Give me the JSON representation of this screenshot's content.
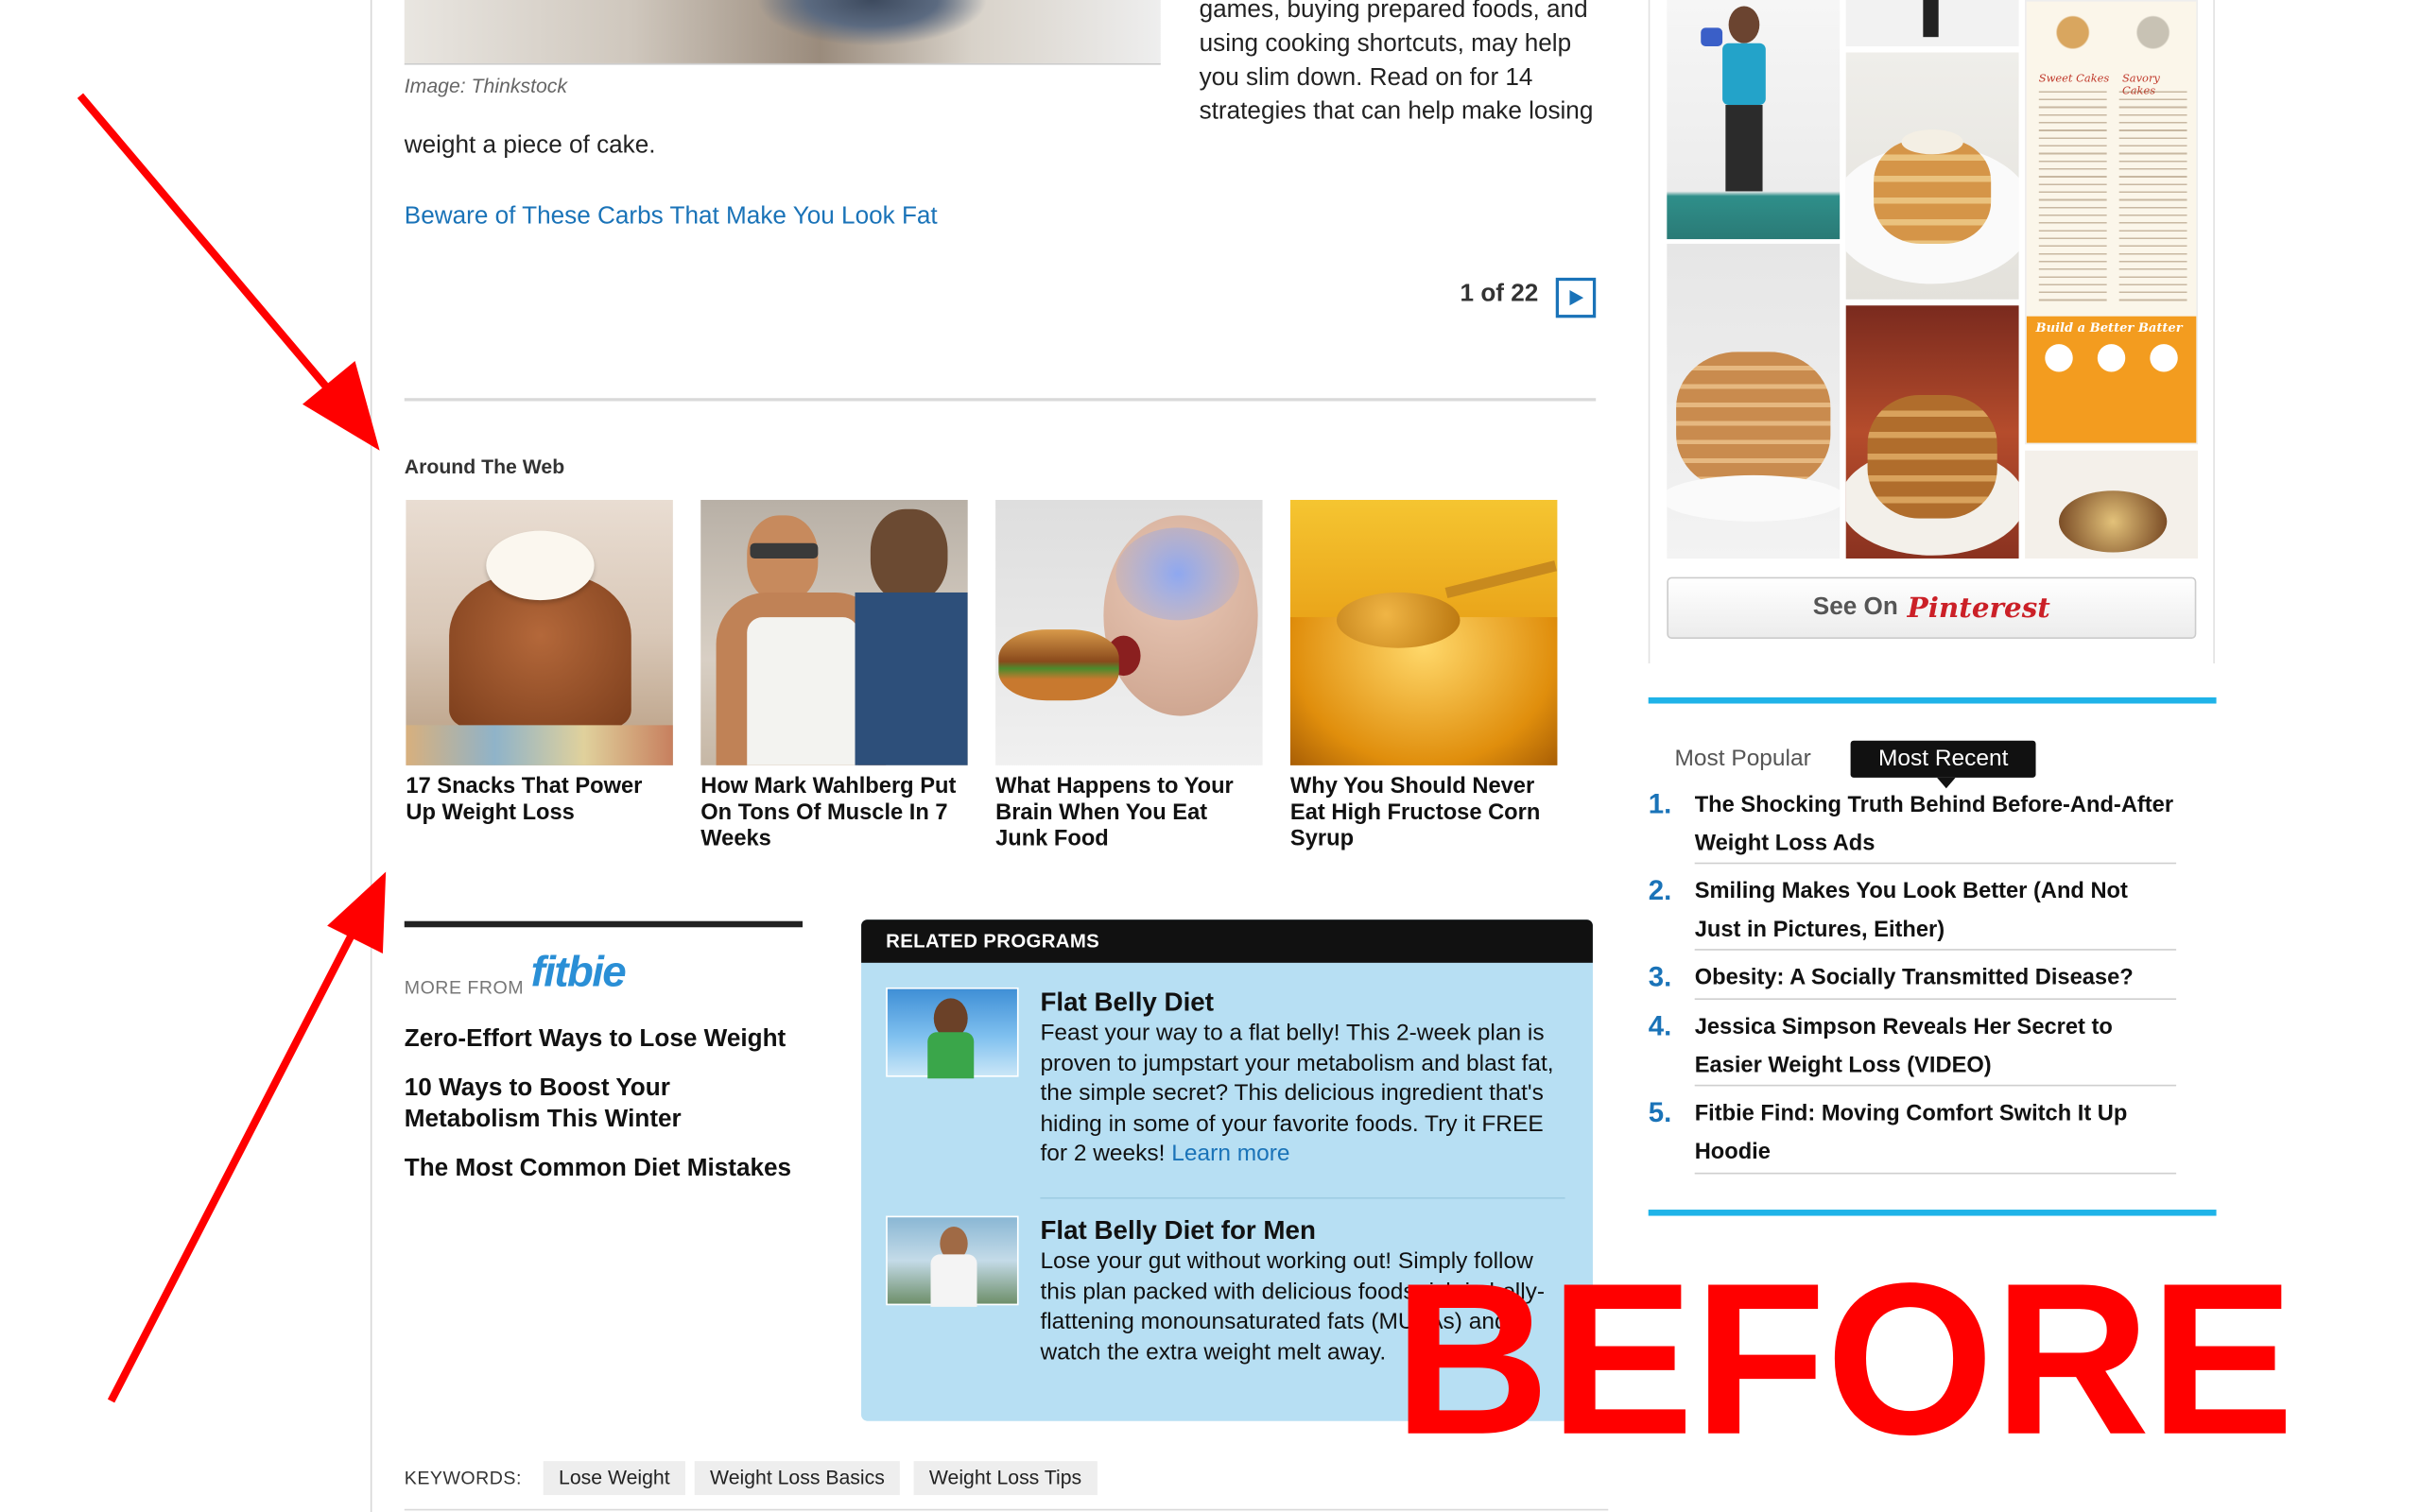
{
  "article": {
    "image_caption": "Image: Thinkstock",
    "left_text_tail": "weight a piece of cake.",
    "right_text_lines": [
      "games, buying prepared foods, and",
      "using cooking shortcuts, may help",
      "you slim down. Read on for 14",
      "strategies that can help make losing"
    ],
    "link_text": "Beware of These Carbs That Make You Look Fat",
    "pager_text": "1 of 22"
  },
  "around_the_web": {
    "title": "Around The Web",
    "items": [
      {
        "label": "17 Snacks That Power Up Weight Loss"
      },
      {
        "label": "How Mark Wahlberg Put On Tons Of Muscle In 7 Weeks"
      },
      {
        "label": "What Happens to Your Brain When You Eat Junk Food"
      },
      {
        "label": "Why You Should Never Eat High Fructose Corn Syrup"
      }
    ]
  },
  "more_from": {
    "prefix": "MORE FROM",
    "brand": "fitbie",
    "links": [
      "Zero-Effort Ways to Lose Weight",
      "10 Ways to Boost Your Metabolism This Winter",
      "The Most Common Diet Mistakes"
    ]
  },
  "related_programs": {
    "title": "RELATED PROGRAMS",
    "items": [
      {
        "title": "Flat Belly Diet",
        "text": "Feast your way to a flat belly! This 2-week plan is proven to jumpstart your metabolism and blast fat, the simple secret? This delicious ingredient that's hiding in some of your favorite foods. Try it FREE for 2 weeks!",
        "link": "Learn more"
      },
      {
        "title": "Flat Belly Diet for Men",
        "text": "Lose your gut without working out! Simply follow this plan packed with delicious foods rich in belly-flattening monounsaturated fats (MUFAs) and watch the extra weight melt away."
      }
    ]
  },
  "keywords": {
    "label": "KEYWORDS:",
    "tags": [
      "Lose Weight",
      "Weight Loss Basics",
      "Weight Loss Tips"
    ]
  },
  "sidebar": {
    "pinterest_see": "See On",
    "pinterest_brand": "Pinterest",
    "tabs": {
      "popular": "Most Popular",
      "recent": "Most Recent"
    },
    "items": [
      {
        "num": "1.",
        "title": "The Shocking Truth Behind Before-And-After Weight Loss Ads"
      },
      {
        "num": "2.",
        "title": "Smiling Makes You Look Better (And Not Just in Pictures, Either)"
      },
      {
        "num": "3.",
        "title": "Obesity: A Socially Transmitted Disease?"
      },
      {
        "num": "4.",
        "title": "Jessica Simpson Reveals Her Secret to Easier Weight Loss (VIDEO)"
      },
      {
        "num": "5.",
        "title": "Fitbie Find: Moving Comfort Switch It Up Hoodie"
      }
    ],
    "infographic_labels": [
      "Sweet Cakes",
      "Savory Cakes",
      "Build a Better Batter"
    ]
  },
  "annotation": {
    "overlay_text": "BEFORE",
    "color": "#ff0000"
  },
  "colors": {
    "link_blue": "#1a73b8",
    "accent_cyan": "#1fb3e8",
    "program_bg": "#b7dff3",
    "pinterest_red": "#cb2027"
  }
}
